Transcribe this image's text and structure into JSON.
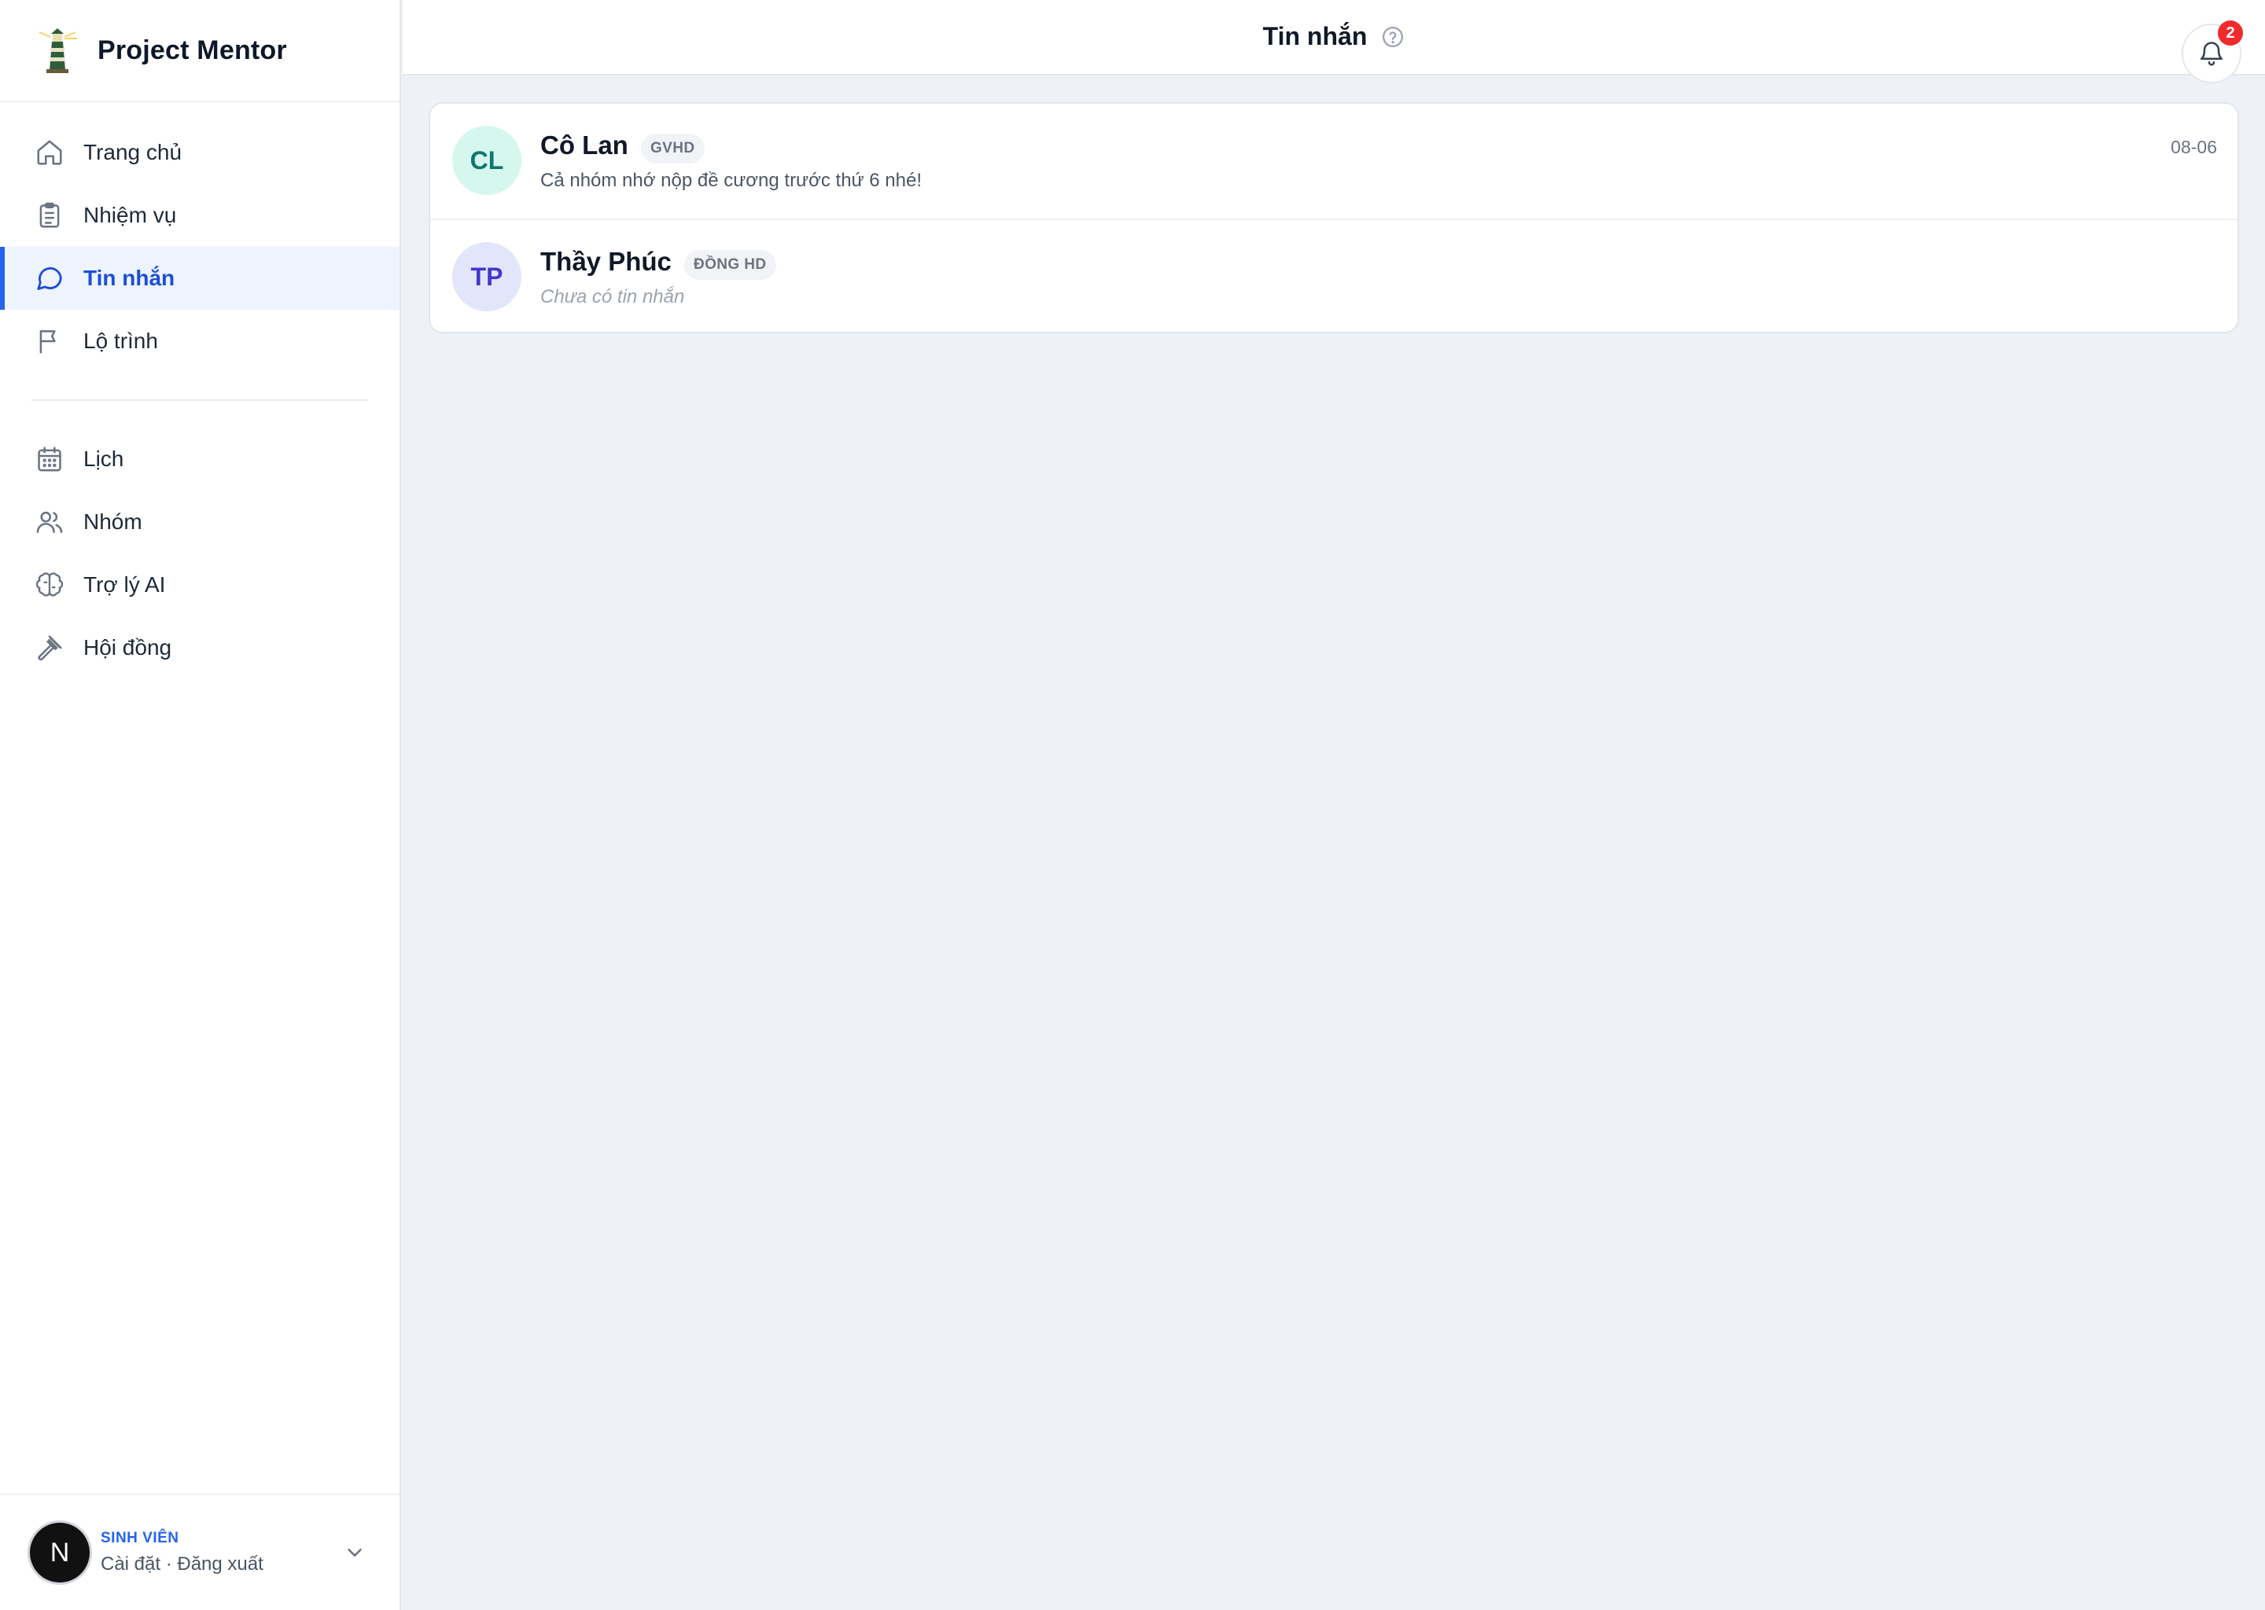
{
  "brand": {
    "name": "Project Mentor",
    "logo_icon": "lighthouse-icon"
  },
  "sidebar": {
    "primary": [
      {
        "label": "Trang chủ",
        "icon": "home-icon"
      },
      {
        "label": "Nhiệm vụ",
        "icon": "clipboard-icon"
      },
      {
        "label": "Tin nhắn",
        "icon": "chat-icon",
        "active": true
      },
      {
        "label": "Lộ trình",
        "icon": "flag-icon"
      }
    ],
    "secondary": [
      {
        "label": "Lịch",
        "icon": "calendar-icon"
      },
      {
        "label": "Nhóm",
        "icon": "users-icon"
      },
      {
        "label": "Trợ lý AI",
        "icon": "brain-icon"
      },
      {
        "label": "Hội đồng",
        "icon": "gavel-icon"
      }
    ]
  },
  "user": {
    "initial": "N",
    "role": "SINH VIÊN",
    "links": "Cài đặt · Đăng xuất"
  },
  "header": {
    "title": "Tin nhắn",
    "notification_count": "2"
  },
  "conversations": [
    {
      "initials": "CL",
      "name": "Cô Lan",
      "tag": "GVHD",
      "preview": "Cả nhóm nhớ nộp đề cương trước thứ 6 nhé!",
      "time": "08-06",
      "avatar_bg": "#d5f7ee",
      "avatar_fg": "#0f766e"
    },
    {
      "initials": "TP",
      "name": "Thầy Phúc",
      "tag": "ĐỒNG HD",
      "preview": "Chưa có tin nhắn",
      "time": "",
      "avatar_bg": "#e3e6fb",
      "avatar_fg": "#4338ca"
    }
  ],
  "colors": {
    "accent": "#2563eb",
    "active_bg": "#eef4ff",
    "badge": "#ef2b2b",
    "page_bg": "#eef1f6"
  }
}
